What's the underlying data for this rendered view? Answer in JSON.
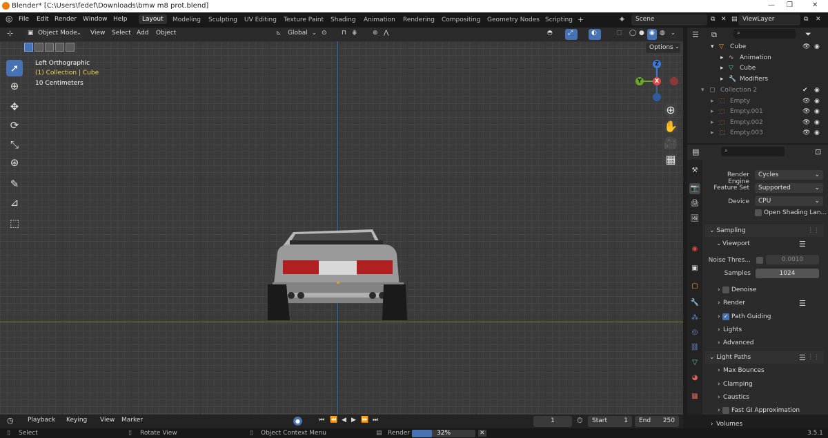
{
  "title_bar": {
    "text": "Blender* [C:\\Users\\fedef\\Downloads\\bmw m8 prot.blend]",
    "minimize": "—",
    "maximize": "❐",
    "close": "✕"
  },
  "menu": {
    "items": [
      "File",
      "Edit",
      "Render",
      "Window",
      "Help"
    ]
  },
  "workspaces": {
    "tabs": [
      "Layout",
      "Modeling",
      "Sculpting",
      "UV Editing",
      "Texture Paint",
      "Shading",
      "Animation",
      "Rendering",
      "Compositing",
      "Geometry Nodes",
      "Scripting"
    ],
    "add": "+",
    "active": "Layout"
  },
  "scene": {
    "label": "Scene",
    "view_layer": "ViewLayer"
  },
  "viewport_header": {
    "mode": "Object Mode",
    "menus": [
      "View",
      "Select",
      "Add",
      "Object"
    ],
    "transform": "Global",
    "options": "Options"
  },
  "viewport": {
    "view_name": "Left Orthographic",
    "collection_info": "(1) Collection | Cube",
    "scale": "10 Centimeters"
  },
  "gizmo": {
    "z": "Z",
    "y": "Y",
    "x": "X"
  },
  "outliner": {
    "rows": [
      {
        "label": "Cube",
        "indent": 1,
        "dim": false,
        "icon": "▽",
        "icon_color": "#e8a040",
        "eye": "👁",
        "cam": "◉"
      },
      {
        "label": "Animation",
        "indent": 2,
        "dim": false,
        "icon": "∿",
        "icon_color": "#c8c8c8",
        "eye": "",
        "cam": ""
      },
      {
        "label": "Cube",
        "indent": 2,
        "dim": false,
        "icon": "▽",
        "icon_color": "#5fd0c2",
        "eye": "",
        "cam": ""
      },
      {
        "label": "Modifiers",
        "indent": 2,
        "dim": false,
        "icon": "🔧",
        "icon_color": "#6a8fd8",
        "eye": "",
        "cam": ""
      },
      {
        "label": "Collection 2",
        "indent": 0,
        "dim": true,
        "icon": "▢",
        "icon_color": "#9a9a9a",
        "eye": "✔",
        "cam": "◉"
      },
      {
        "label": "Empty",
        "indent": 1,
        "dim": true,
        "icon": "⬚",
        "icon_color": "#c07050",
        "eye": "👁",
        "cam": "◉"
      },
      {
        "label": "Empty.001",
        "indent": 1,
        "dim": true,
        "icon": "⬚",
        "icon_color": "#c07050",
        "eye": "👁",
        "cam": "◉"
      },
      {
        "label": "Empty.002",
        "indent": 1,
        "dim": true,
        "icon": "⬚",
        "icon_color": "#c07050",
        "eye": "👁",
        "cam": "◉"
      },
      {
        "label": "Empty.003",
        "indent": 1,
        "dim": true,
        "icon": "⬚",
        "icon_color": "#c07050",
        "eye": "👁",
        "cam": "◉"
      }
    ]
  },
  "properties": {
    "render_engine_label": "Render Engine",
    "render_engine": "Cycles",
    "feature_set_label": "Feature Set",
    "feature_set": "Supported",
    "device_label": "Device",
    "device": "CPU",
    "open_shading": "Open Shading Lan...",
    "sampling": "Sampling",
    "viewport_sub": "Viewport",
    "noise_label": "Noise Thres...",
    "noise_value": "0.0010",
    "samples_label": "Samples",
    "samples_value": "1024",
    "denoise": "Denoise",
    "render": "Render",
    "path_guiding": "Path Guiding",
    "lights": "Lights",
    "advanced": "Advanced",
    "light_paths": "Light Paths",
    "max_bounces": "Max Bounces",
    "clamping": "Clamping",
    "caustics": "Caustics",
    "fast_gi": "Fast GI Approximation",
    "volumes": "Volumes"
  },
  "timeline": {
    "menus": [
      "Playback",
      "Keying",
      "View",
      "Marker"
    ],
    "current_frame": "1",
    "start_label": "Start",
    "start": "1",
    "end_label": "End",
    "end": "250"
  },
  "status_bar": {
    "select": "Select",
    "rotate": "Rotate View",
    "context": "Object Context Menu",
    "render": "Render",
    "progress": "32%",
    "version": "3.5.1"
  }
}
